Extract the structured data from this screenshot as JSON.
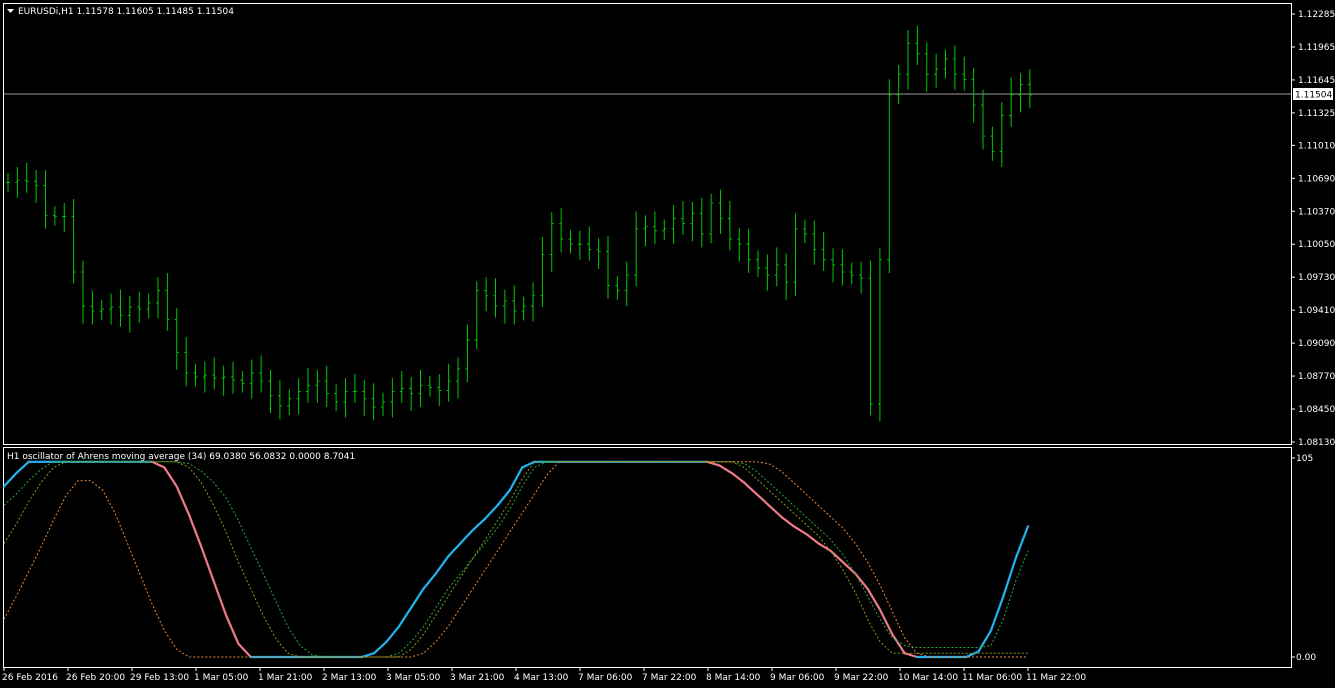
{
  "window": {
    "menu_arrow": "triangle-down-icon",
    "symbol_header": "EURUSDi,H1  1.11578 1.11605 1.11485 1.11504",
    "indicator_header": "H1 oscillator of Ahrens moving average (34) 69.0380 56.0832 0.0000 8.7041"
  },
  "colors": {
    "background": "#000000",
    "grid_frame": "#ffffff",
    "bars": "#00c800",
    "osc_up": "#22b4f0",
    "osc_down": "#f07a8a",
    "signal_green": "#2aa83a",
    "signal_orange": "#e8883a",
    "signal_olive": "#8a9a1a"
  },
  "chart_data": [
    {
      "type": "ohlc",
      "title": "EURUSDi,H1",
      "last_price": "1.11504",
      "y_ticks": [
        "1.12285",
        "1.11965",
        "1.11645",
        "1.11325",
        "1.11010",
        "1.10690",
        "1.10370",
        "1.10050",
        "1.09730",
        "1.09410",
        "1.09090",
        "1.08770",
        "1.08450",
        "1.08130"
      ],
      "ylim": [
        1.0813,
        1.12285
      ],
      "x_ticks": [
        "26 Feb 2016",
        "26 Feb 20:00",
        "29 Feb 13:00",
        "1 Mar 05:00",
        "1 Mar 21:00",
        "2 Mar 13:00",
        "3 Mar 05:00",
        "3 Mar 21:00",
        "4 Mar 13:00",
        "7 Mar 06:00",
        "7 Mar 22:00",
        "8 Mar 14:00",
        "9 Mar 06:00",
        "9 Mar 22:00",
        "10 Mar 14:00",
        "11 Mar 06:00",
        "11 Mar 22:00"
      ],
      "close_path": [
        1.1065,
        1.1067,
        1.1066,
        1.1062,
        1.1033,
        1.1032,
        1.1032,
        1.0978,
        1.0945,
        1.094,
        1.0942,
        1.0944,
        1.0936,
        1.0944,
        1.0942,
        1.0948,
        1.096,
        1.0932,
        1.09,
        1.088,
        1.0876,
        1.0878,
        1.0875,
        1.0876,
        1.0873,
        1.087,
        1.088,
        1.0872,
        1.0858,
        1.0848,
        1.0855,
        1.0862,
        1.0868,
        1.0872,
        1.086,
        1.0852,
        1.0862,
        1.0862,
        1.0855,
        1.0847,
        1.0852,
        1.0862,
        1.0865,
        1.086,
        1.0868,
        1.0866,
        1.0863,
        1.0872,
        1.0884,
        1.0912,
        1.096,
        1.0955,
        1.0945,
        1.095,
        1.094,
        1.0945,
        1.0955,
        1.0995,
        1.1025,
        1.101,
        1.1005,
        1.1005,
        1.1,
        1.0998,
        1.0965,
        1.096,
        1.0975,
        1.102,
        1.1022,
        1.1018,
        1.102,
        1.103,
        1.1025,
        1.1035,
        1.1015,
        1.1045,
        1.103,
        1.101,
        1.1005,
        1.099,
        1.0982,
        1.0975,
        1.0985,
        1.0968,
        1.102,
        1.1015,
        1.1,
        1.099,
        1.0985,
        1.0978,
        1.0975,
        1.0972,
        1.085,
        1.099,
        1.115,
        1.117,
        1.12,
        1.119,
        1.117,
        1.1175,
        1.1185,
        1.117,
        1.1165,
        1.114,
        1.111,
        1.1095,
        1.113,
        1.115,
        1.116,
        1.115
      ]
    },
    {
      "type": "line",
      "title": "H1 oscillator of Ahrens moving average (34)",
      "header_values": [
        "69.0380",
        "56.0832",
        "0.0000",
        "8.7041"
      ],
      "y_ticks": [
        "105",
        "0.00"
      ],
      "ylim": [
        0,
        105
      ],
      "series": [
        {
          "name": "",
          "kind": "main",
          "values": [
            90,
            97,
            103,
            103,
            103,
            103,
            103,
            103,
            103,
            103,
            103,
            103,
            103,
            100,
            90,
            75,
            58,
            40,
            22,
            7,
            0,
            0,
            0,
            0,
            0,
            0,
            0,
            0,
            0,
            0,
            2,
            8,
            16,
            26,
            36,
            44,
            53,
            60,
            67,
            73,
            80,
            88,
            100,
            103,
            103,
            103,
            103,
            103,
            103,
            103,
            103,
            103,
            103,
            103,
            103,
            103,
            103,
            103,
            101,
            97,
            92,
            86,
            80,
            74,
            69,
            65,
            60,
            56,
            50,
            44,
            36,
            25,
            12,
            2,
            0,
            0,
            0,
            0,
            0,
            3,
            14,
            32,
            52,
            69
          ]
        },
        {
          "name": "",
          "kind": "signal_green",
          "values": [
            80,
            86,
            93,
            99,
            103,
            103,
            103,
            103,
            103,
            103,
            103,
            103,
            103,
            103,
            103,
            102,
            98,
            92,
            84,
            72,
            58,
            44,
            30,
            16,
            6,
            1,
            0,
            0,
            0,
            0,
            0,
            0,
            2,
            8,
            16,
            26,
            36,
            44,
            52,
            60,
            68,
            78,
            90,
            100,
            103,
            103,
            103,
            103,
            103,
            103,
            103,
            103,
            103,
            103,
            103,
            103,
            103,
            103,
            103,
            103,
            102,
            98,
            92,
            86,
            80,
            74,
            68,
            62,
            54,
            44,
            32,
            20,
            10,
            6,
            5,
            5,
            5,
            5,
            5,
            5,
            6,
            20,
            40,
            56
          ]
        },
        {
          "name": "",
          "kind": "signal_orange",
          "values": [
            20,
            32,
            45,
            58,
            72,
            85,
            93,
            93,
            88,
            76,
            60,
            44,
            28,
            14,
            4,
            0,
            0,
            0,
            0,
            0,
            0,
            0,
            0,
            0,
            0,
            0,
            0,
            0,
            0,
            0,
            0,
            0,
            0,
            0,
            2,
            8,
            16,
            26,
            36,
            46,
            56,
            66,
            76,
            86,
            96,
            103,
            103,
            103,
            103,
            103,
            103,
            103,
            103,
            103,
            103,
            103,
            103,
            103,
            103,
            103,
            103,
            103,
            102,
            98,
            92,
            86,
            80,
            74,
            68,
            60,
            50,
            38,
            24,
            10,
            2,
            0,
            0,
            0,
            0,
            0,
            0,
            0,
            0,
            0
          ]
        },
        {
          "name": "",
          "kind": "signal_olive",
          "values": [
            60,
            70,
            82,
            92,
            100,
            103,
            103,
            103,
            103,
            103,
            103,
            103,
            103,
            103,
            103,
            100,
            92,
            80,
            66,
            50,
            36,
            22,
            10,
            2,
            0,
            0,
            0,
            0,
            0,
            0,
            0,
            0,
            0,
            4,
            12,
            22,
            32,
            42,
            52,
            62,
            72,
            82,
            94,
            103,
            103,
            103,
            103,
            103,
            103,
            103,
            103,
            103,
            103,
            103,
            103,
            103,
            103,
            103,
            103,
            103,
            100,
            94,
            88,
            82,
            76,
            70,
            64,
            56,
            46,
            34,
            20,
            8,
            2,
            2,
            2,
            2,
            2,
            2,
            2,
            2,
            2,
            2,
            2,
            2
          ]
        }
      ]
    }
  ]
}
